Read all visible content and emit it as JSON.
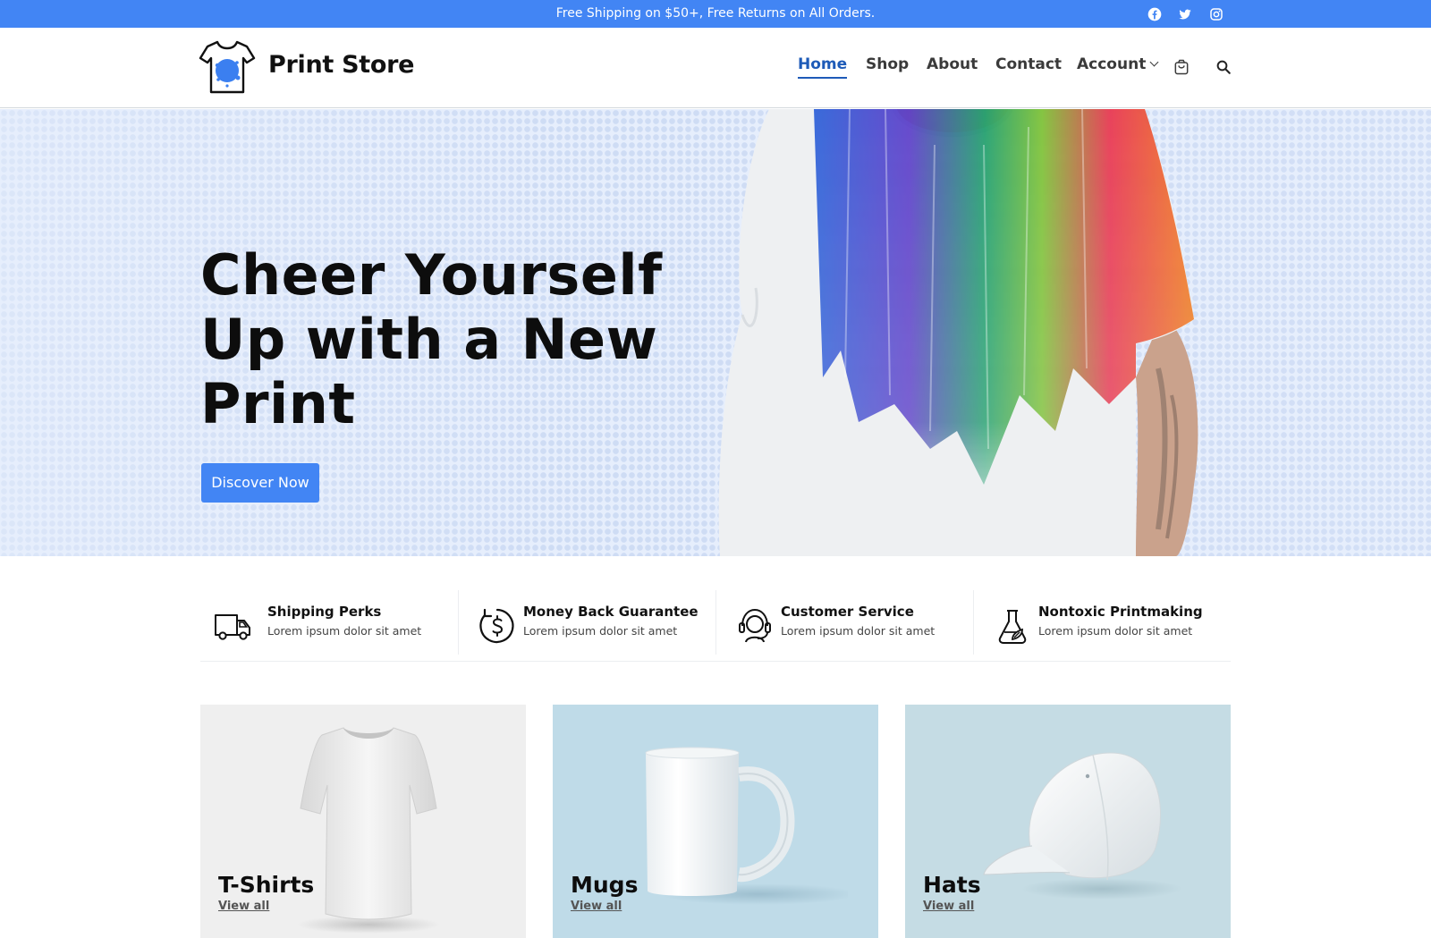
{
  "topbar": {
    "message": "Free Shipping on $50+, Free Returns on All Orders.",
    "social": [
      "facebook-icon",
      "twitter-icon",
      "instagram-icon"
    ]
  },
  "header": {
    "logo_text": "Print Store",
    "nav": [
      {
        "label": "Home",
        "active": true
      },
      {
        "label": "Shop",
        "active": false
      },
      {
        "label": "About",
        "active": false
      },
      {
        "label": "Contact",
        "active": false
      },
      {
        "label": "Account",
        "active": false,
        "dropdown": true
      }
    ],
    "icons": [
      "cart-icon",
      "search-icon"
    ]
  },
  "hero": {
    "title_lines": [
      "Cheer Yourself",
      "Up with a New",
      "Print"
    ],
    "button_label": "Discover Now"
  },
  "features": [
    {
      "icon": "truck-icon",
      "title": "Shipping Perks",
      "subtitle": "Lorem ipsum dolor sit amet"
    },
    {
      "icon": "money-back-icon",
      "title": "Money Back Guarantee",
      "subtitle": "Lorem ipsum dolor sit amet"
    },
    {
      "icon": "headset-icon",
      "title": "Customer Service",
      "subtitle": "Lorem ipsum dolor sit amet"
    },
    {
      "icon": "flask-icon",
      "title": "Nontoxic Printmaking",
      "subtitle": "Lorem ipsum dolor sit amet"
    }
  ],
  "categories": [
    {
      "title": "T-Shirts",
      "link": "View all",
      "bg": "#efefef"
    },
    {
      "title": "Mugs",
      "link": "View all",
      "bg": "#bfdbe8"
    },
    {
      "title": "Hats",
      "link": "View all",
      "bg": "#c5dce4"
    }
  ],
  "colors": {
    "accent": "#4285f4",
    "nav_active": "#1e5bb8"
  }
}
